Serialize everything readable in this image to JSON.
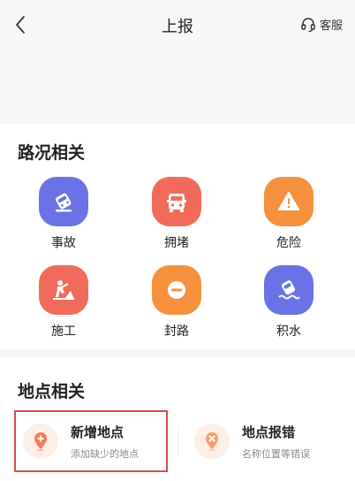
{
  "header": {
    "title": "上报",
    "service_label": "客服"
  },
  "traffic_section": {
    "title": "路况相关",
    "items": [
      {
        "label": "事故",
        "icon": "car-crash-icon",
        "color": "#6a73e6"
      },
      {
        "label": "拥堵",
        "icon": "traffic-jam-car-icon",
        "color": "#f26b5a"
      },
      {
        "label": "危险",
        "icon": "warning-icon",
        "color": "#f5913c"
      },
      {
        "label": "施工",
        "icon": "construction-worker-icon",
        "color": "#f26b5a"
      },
      {
        "label": "封路",
        "icon": "road-closed-icon",
        "color": "#f5913c"
      },
      {
        "label": "积水",
        "icon": "flooded-car-icon",
        "color": "#6a73e6"
      }
    ]
  },
  "places_section": {
    "title": "地点相关",
    "cards": [
      {
        "title": "新增地点",
        "subtitle": "添加缺少的地点",
        "icon": "add-location-pin-icon"
      },
      {
        "title": "地点报错",
        "subtitle": "名称位置等错误",
        "icon": "location-error-pin-icon"
      }
    ]
  }
}
